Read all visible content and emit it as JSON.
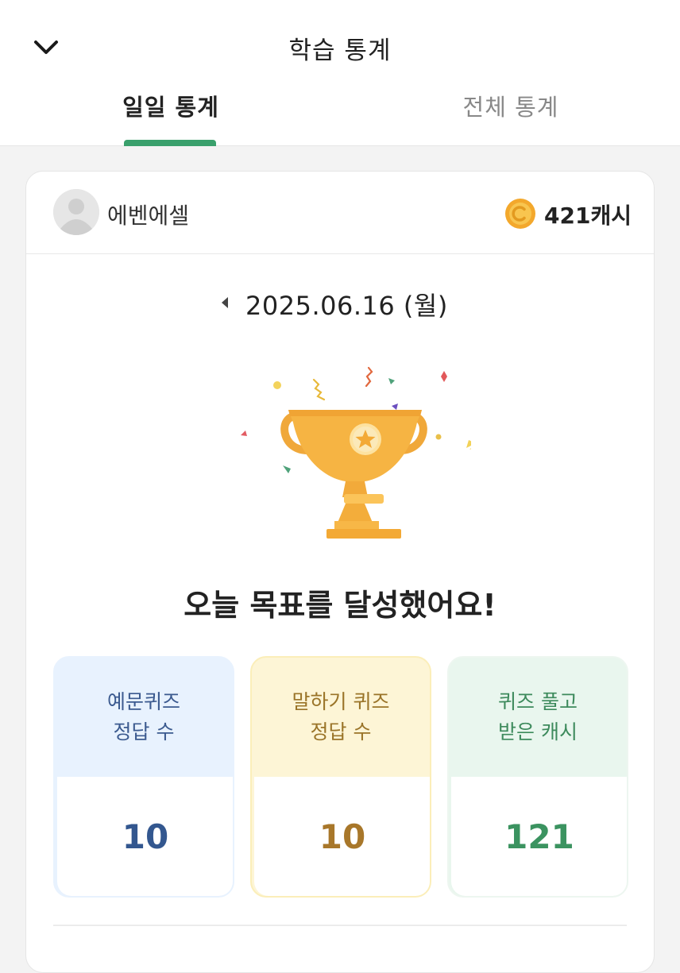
{
  "header": {
    "title": "학습 통계",
    "back_icon": "chevron-down-icon"
  },
  "tabs": [
    {
      "label": "일일 통계",
      "active": true
    },
    {
      "label": "전체 통계",
      "active": false
    }
  ],
  "profile": {
    "username": "에벤에셀",
    "cash": "421캐시"
  },
  "date": {
    "text": "2025.06.16 (월)"
  },
  "goal_message": "오늘 목표를 달성했어요!",
  "stats": [
    {
      "line1": "예문퀴즈",
      "line2": "정답 수",
      "value": "10"
    },
    {
      "line1": "말하기 퀴즈",
      "line2": "정답 수",
      "value": "10"
    },
    {
      "line1": "퀴즈 풀고",
      "line2": "받은 캐시",
      "value": "121"
    }
  ],
  "colors": {
    "accent_green": "#3aa06c",
    "trophy_gold": "#f5b342",
    "coin_gold": "#f6b73c"
  }
}
